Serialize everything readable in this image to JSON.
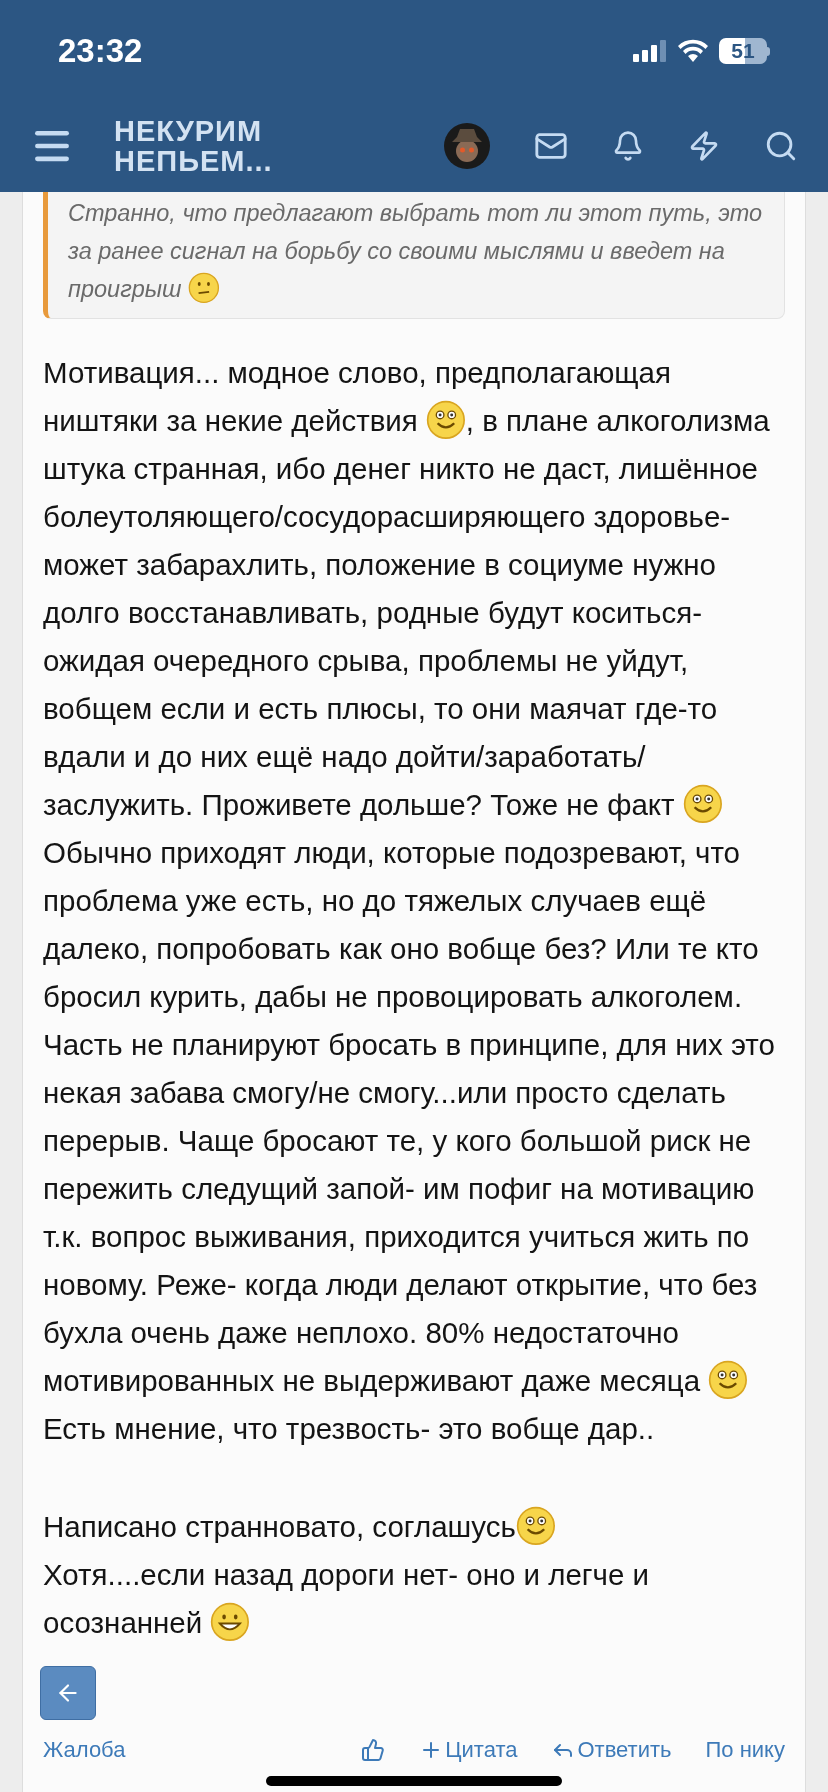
{
  "status_bar": {
    "time": "23:32",
    "battery": "51"
  },
  "header": {
    "logo_lines": [
      "НЕКУРИМ",
      "НЕПЬЕМ..."
    ]
  },
  "quote": {
    "segments": [
      {
        "kind": "text",
        "text": "Странно, что предлагают выбрать тот ли этот путь, это за ранее сигнал на борьбу со своими мыслями и введет на проигрыш "
      },
      {
        "kind": "confused"
      }
    ]
  },
  "paragraphs": [
    {
      "segments": [
        {
          "kind": "text",
          "text": "Мотивация... модное слово, предполагающая ништяки за некие действия "
        },
        {
          "kind": "smile"
        },
        {
          "kind": "text",
          "text": ", в плане алкоголизма штука странная, ибо денег никто не даст, лишённое болеутоляющего/сосудорасширяющего здоровье- может забарахлить, положение в социуме нужно долго восстанавливать, родные будут коситься- ожидая очередного срыва, проблемы не уйдут, вобщем если и есть плюсы, то они маячат где-то вдали и до них ещё надо дойти/заработать/заслужить. Проживете дольше? Тоже не факт "
        },
        {
          "kind": "smile"
        }
      ]
    },
    {
      "segments": [
        {
          "kind": "text",
          "text": "Обычно приходят люди, которые подозревают, что проблема уже есть, но до тяжелых случаев ещё далеко, попробовать как оно вобще без? Или те кто бросил курить, дабы не провоцировать алкоголем. Часть не планируют бросать в принципе, для них это некая забава смогу/не смогу...или просто сделать перерыв. Чаще бросают те, у кого большой риск не пережить следущий запой- им пофиг на мотивацию т.к. вопрос выживания, приходится учиться жить по новому. Реже- когда люди делают открытие, что без бухла очень даже неплохо. 80% недостаточно мотивированных не выдерживают даже месяца "
        },
        {
          "kind": "smile"
        }
      ]
    },
    {
      "segments": [
        {
          "kind": "text",
          "text": "Есть мнение, что трезвость- это вобще дар.."
        }
      ]
    },
    {
      "kind": "blank_line"
    },
    {
      "segments": [
        {
          "kind": "text",
          "text": "Написано странновато, соглашусь"
        },
        {
          "kind": "smile"
        }
      ]
    },
    {
      "segments": [
        {
          "kind": "text",
          "text": "Хотя....если назад дороги нет- оно и легче и осознанней "
        },
        {
          "kind": "grin"
        }
      ]
    }
  ],
  "actions": [
    {
      "kind": "report",
      "label": "Жалоба"
    },
    {
      "kind": "like"
    },
    {
      "kind": "quote",
      "label": "Цитата"
    },
    {
      "kind": "reply",
      "label": "Ответить"
    },
    {
      "kind": "mention",
      "label": "По нику"
    }
  ]
}
